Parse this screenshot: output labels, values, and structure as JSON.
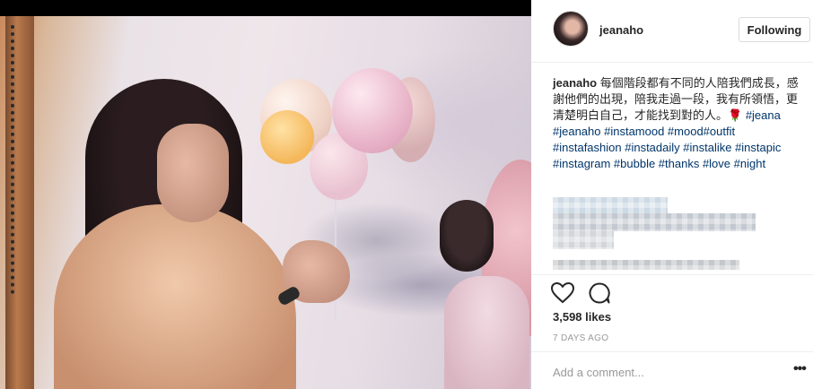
{
  "post": {
    "username": "jeanaho",
    "follow_label": "Following",
    "caption": {
      "username": "jeanaho",
      "text": "每個階段都有不同的人陪我們成長，感謝他們的出現，陪我走過一段，我有所領悟，更清楚明白自己，才能找到對的人。🌹",
      "hashtags": "#jeana #jeanaho #instamood #mood#outfit #instafashion #instadaily #instalike #instapic #instagram #bubble #thanks #love #night"
    },
    "likes": "3,598 likes",
    "time_ago": "7 DAYS AGO",
    "comment_placeholder": "Add a comment...",
    "more_label": "•••"
  },
  "icons": {
    "like": "heart-icon",
    "comment": "comment-icon",
    "more": "more-options-icon"
  },
  "colors": {
    "hashtag": "#003569",
    "muted": "#999999",
    "text": "#262626"
  }
}
